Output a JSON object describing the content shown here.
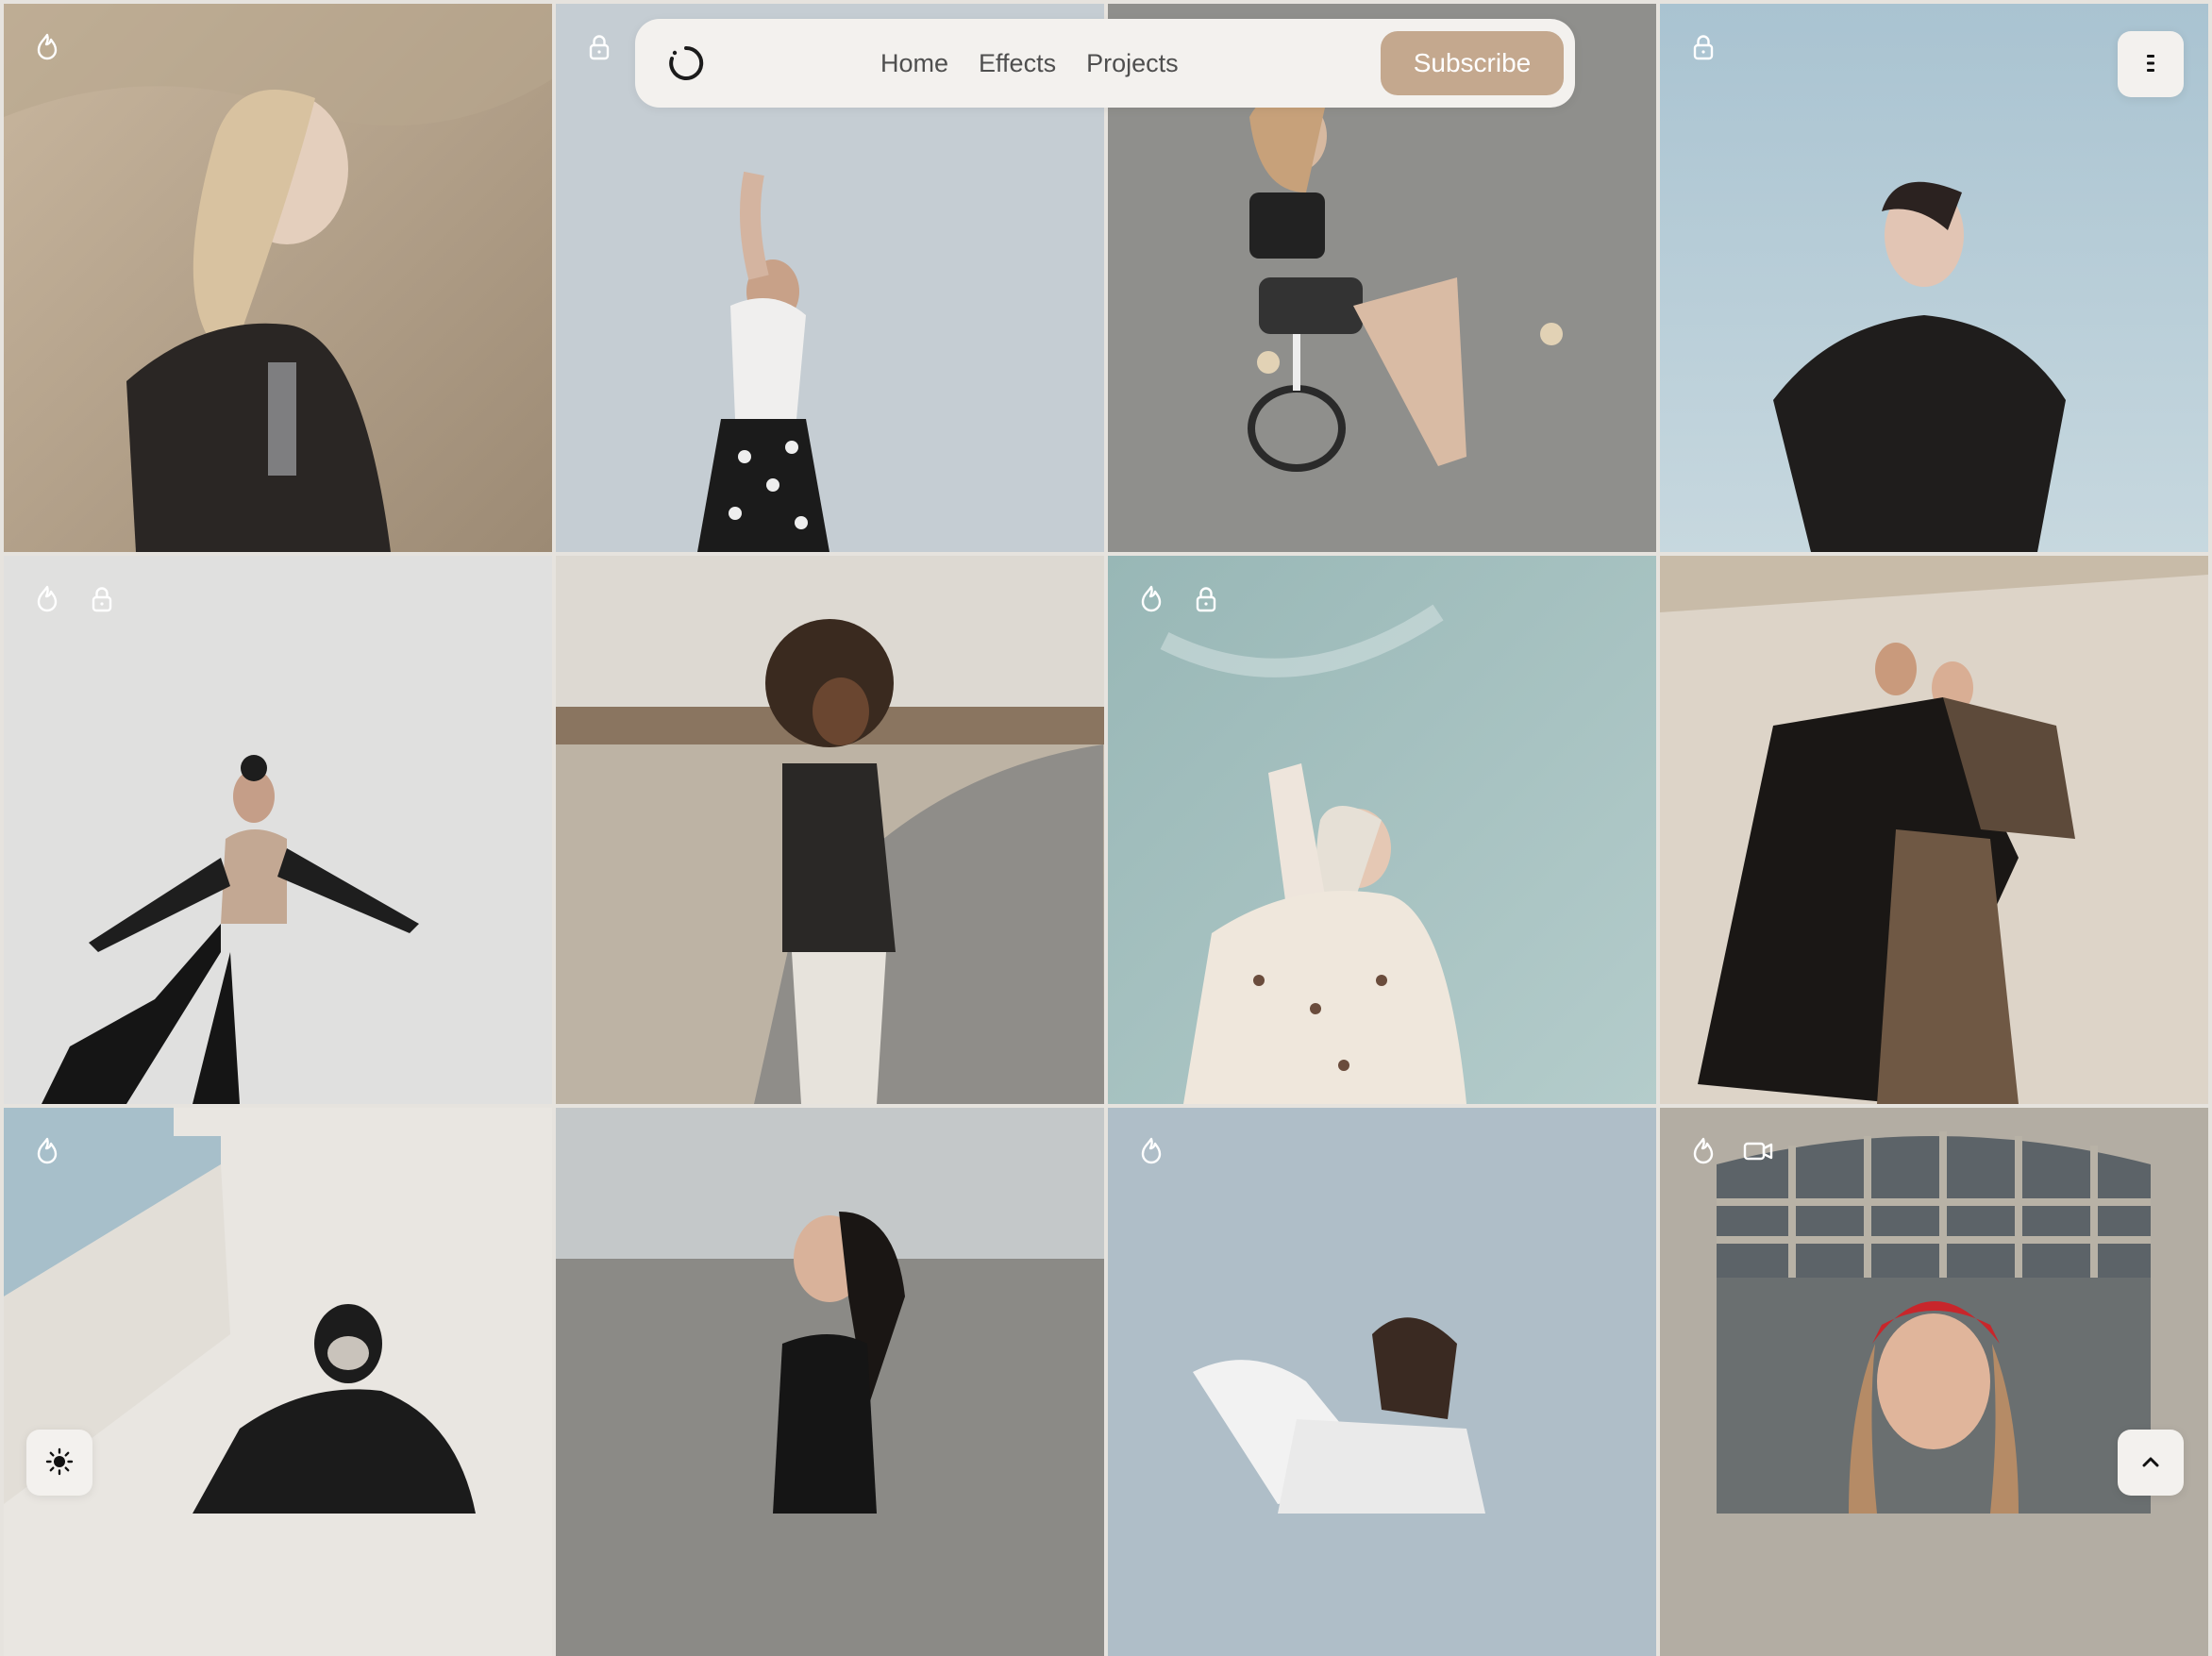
{
  "header": {
    "logo_icon": "spinner-circle-icon",
    "nav": [
      "Home",
      "Effects",
      "Projects"
    ],
    "subscribe_label": "Subscribe",
    "accent_color": "#c4a88e"
  },
  "menu_icon": "vertical-dots-icon",
  "theme_toggle_icon": "sun-icon",
  "scroll_top_icon": "chevron-up-icon",
  "gallery": [
    {
      "badges": [
        "flame-icon"
      ],
      "bg": "#b9a791"
    },
    {
      "badges": [
        "lock-icon"
      ],
      "bg": "#c3cad0"
    },
    {
      "badges": [],
      "bg": "#8e8e8c"
    },
    {
      "badges": [
        "lock-icon"
      ],
      "bg": "#a9c2cf"
    },
    {
      "badges": [
        "flame-icon",
        "lock-icon"
      ],
      "bg": "#dedede"
    },
    {
      "badges": [],
      "bg": "#cfc9c0"
    },
    {
      "badges": [
        "flame-icon",
        "lock-icon"
      ],
      "bg": "#9fbcbc"
    },
    {
      "badges": [],
      "bg": "#d8d0c5"
    },
    {
      "badges": [
        "flame-icon"
      ],
      "bg": "#e4e1dc"
    },
    {
      "badges": [],
      "bg": "#b9bec0"
    },
    {
      "badges": [
        "flame-icon"
      ],
      "bg": "#abbac4"
    },
    {
      "badges": [
        "flame-icon",
        "video-camera-icon"
      ],
      "bg": "#b1aca2"
    }
  ]
}
